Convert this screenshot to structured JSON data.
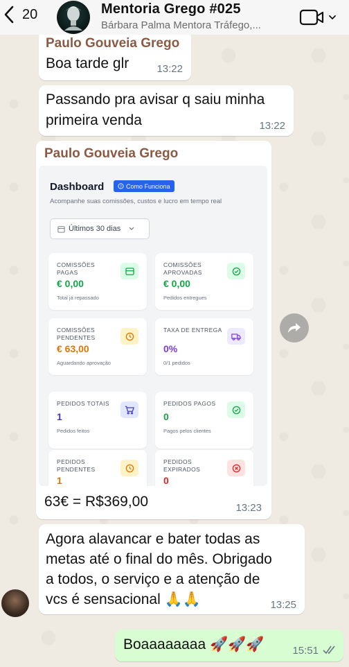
{
  "header": {
    "back_count": "20",
    "title": "Mentoria Grego #025",
    "subtitle": "Bárbara Palma Mentora Tráfego,..."
  },
  "messages": [
    {
      "sender": "Paulo Gouveia Grego",
      "text": "Boa tarde glr",
      "time": "13:22"
    },
    {
      "text_line1": "Passando pra avisar q saiu minha",
      "text_line2": "primeira venda",
      "time": "13:22"
    },
    {
      "sender": "Paulo Gouveia Grego",
      "caption": "63€ = R$369,00",
      "time": "13:23"
    },
    {
      "line1": "Agora alavancar e bater todas as",
      "line2": "metas até o final do mês. Obrigado",
      "line3": "a todos, o serviço e a atenção de",
      "line4": "vcs é sensacional 🙏🙏",
      "time": "13:25"
    },
    {
      "text": "Boaaaaaaaa 🚀🚀🚀",
      "time": "15:51",
      "outgoing": true
    }
  ],
  "dashboard": {
    "title": "Dashboard",
    "badge": "Como Funciona",
    "subtitle": "Acompanhe suas comissões, custos e lucro em tempo real",
    "period": "Últimos 30 dias",
    "cards": [
      {
        "label": "Comissões pagas",
        "value": "€ 0,00",
        "note": "Total já repassado",
        "color": "#16a34a",
        "icon": "card-icon"
      },
      {
        "label": "Comissões aprovadas",
        "value": "€ 0,00",
        "note": "Pedidos entregues",
        "color": "#16a34a",
        "icon": "check-circle-icon"
      },
      {
        "label": "Comissões pendentes",
        "value": "€ 63,00",
        "note": "Aguardando aprovação",
        "color": "#d97706",
        "icon": "clock-icon"
      },
      {
        "label": "Taxa de entrega",
        "value": "0%",
        "note": "0/1 pedidos",
        "color": "#7c3aed",
        "icon": "truck-icon"
      },
      {
        "label": "Pedidos totais",
        "value": "1",
        "note": "Pedidos feitos",
        "color": "#4338ca",
        "icon": "cart-icon"
      },
      {
        "label": "Pedidos pagos",
        "value": "0",
        "note": "Pagos pelos clientes",
        "color": "#16a34a",
        "icon": "check-circle-icon"
      },
      {
        "label": "Pedidos pendentes",
        "value": "1",
        "note": "",
        "color": "#d97706",
        "icon": "clock-icon"
      },
      {
        "label": "Pedidos expirados",
        "value": "0",
        "note": "",
        "color": "#dc2626",
        "icon": "x-circle-icon"
      }
    ]
  }
}
